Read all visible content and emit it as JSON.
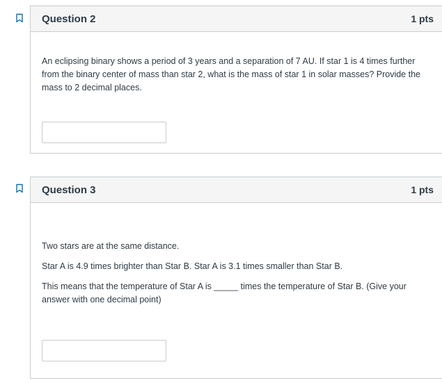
{
  "question2": {
    "title": "Question 2",
    "points": "1 pts",
    "text": "An eclipsing binary shows a period of 3 years and a separation of 7 AU. If star 1 is 4 times further from the binary center of mass than star 2, what is the mass of star 1 in solar masses? Provide the mass to 2 decimal places.",
    "answer_value": "",
    "flag_icon": "bookmark-outline-icon"
  },
  "question3": {
    "title": "Question 3",
    "points": "1 pts",
    "line1": "Two stars are at the same distance.",
    "line2": "Star A is 4.9 times brighter than Star B. Star A is 3.1 times smaller than Star B.",
    "line3_before": "This means that the temperature of Star A is",
    "line3_blank": "_____",
    "line3_after": "times the temperature of Star B. (Give your answer with one decimal point)",
    "answer_value": "",
    "flag_icon": "bookmark-outline-icon"
  },
  "colors": {
    "border": "#c7cdd1",
    "header_bg": "#f5f5f5",
    "text": "#2d3b45",
    "flag": "#0374b5"
  }
}
